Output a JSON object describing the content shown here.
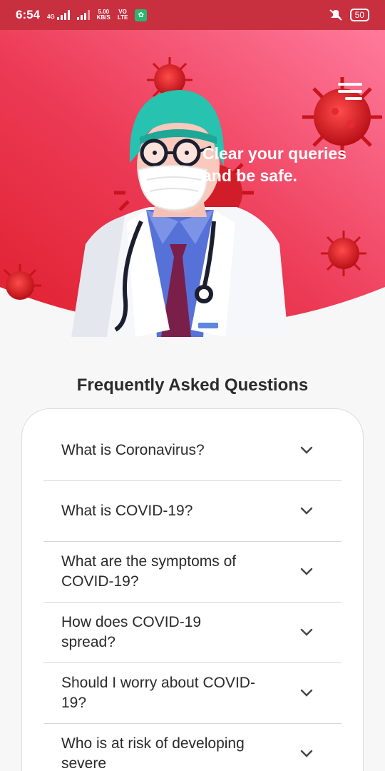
{
  "status_bar": {
    "time": "6:54",
    "network_top": "4G",
    "speed_value": "5.00",
    "speed_unit": "KB/S",
    "volte_top": "VO",
    "volte_bottom": "LTE",
    "battery": "50"
  },
  "hero": {
    "tagline_line1": "Clear your queries",
    "tagline_line2": "and be safe."
  },
  "faq": {
    "title": "Frequently Asked Questions",
    "items": [
      {
        "question": "What is Coronavirus?"
      },
      {
        "question": "What is COVID-19?"
      },
      {
        "question": "What are the symptoms of COVID-19?"
      },
      {
        "question": "How does COVID-19 spread?"
      },
      {
        "question": "Should I worry about COVID-19?"
      },
      {
        "question": "Who is at risk of developing severe"
      }
    ]
  },
  "colors": {
    "hero_top": "#ff6f91",
    "hero_bottom": "#e8243a",
    "virus": "#d8141e",
    "scrub_cap": "#27c2b0",
    "background": "#f7f7f7"
  },
  "icons": [
    "menu-icon",
    "chevron-down-icon",
    "silent-mode-icon",
    "signal-icon"
  ]
}
